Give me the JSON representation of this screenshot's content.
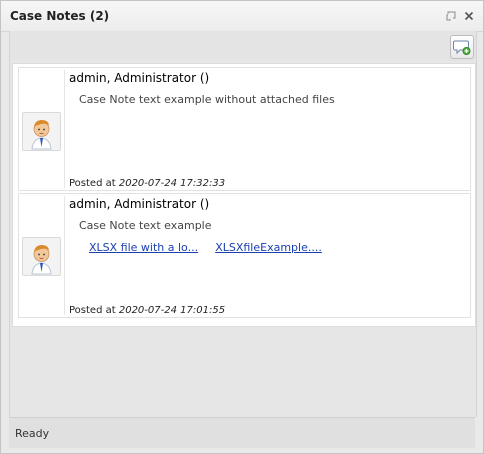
{
  "window": {
    "title": "Case Notes (2)"
  },
  "toolbar": {
    "add_note_icon": "comment-add-icon"
  },
  "notes": [
    {
      "author": "admin, Administrator ()",
      "text": "Case Note text example without attached files",
      "posted_label": "Posted at",
      "posted_at": "2020-07-24 17:32:33",
      "attachments": []
    },
    {
      "author": "admin, Administrator ()",
      "text": "Case Note text example",
      "posted_label": "Posted at",
      "posted_at": "2020-07-24 17:01:55",
      "attachments": [
        "XLSX file with a lo...",
        "XLSXfileExample...."
      ]
    }
  ],
  "status": {
    "text": "Ready"
  }
}
